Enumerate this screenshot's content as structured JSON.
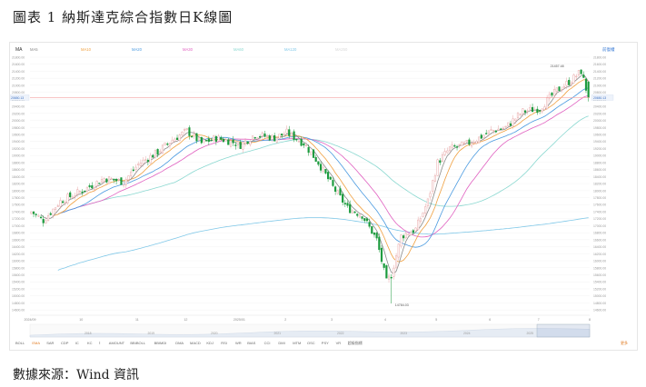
{
  "page": {
    "title": "圖表 1 納斯達克綜合指數日K線圖",
    "source": "數據來源：Wind 資訊"
  },
  "toolbar": {
    "ma_button": "MA",
    "ma_legend": [
      "MA5",
      "MA10",
      "MA20",
      "MA30",
      "MA60",
      "MA120",
      "MA250"
    ],
    "right_label": "前復權"
  },
  "colors": {
    "up": "#e8a8a8",
    "down": "#1a9a3c",
    "ma5": "#8a8a8a",
    "ma10": "#f0a040",
    "ma20": "#4a9ae0",
    "ma30": "#e060c0",
    "ma60": "#8ad8d0",
    "ma120": "#80c8e8",
    "ma250": "#d8d8d8",
    "highlight_line": "#f4a0a0"
  },
  "chart_data": {
    "type": "candlestick",
    "ylim": [
      14500,
      21800
    ],
    "y_ticks": [
      14600,
      14800,
      15000,
      15200,
      15400,
      15600,
      15800,
      16000,
      16200,
      16400,
      16600,
      16800,
      17000,
      17200,
      17400,
      17600,
      17800,
      18000,
      18200,
      18400,
      18600,
      18800,
      19000,
      19200,
      19400,
      19600,
      19800,
      20000,
      20200,
      20400,
      20600,
      20800,
      21000,
      21200,
      21400,
      21600,
      21800
    ],
    "x_labels": [
      "2024/09",
      "10",
      "11",
      "12",
      "2025/01",
      "2",
      "3",
      "4",
      "5",
      "6",
      "7",
      "8"
    ],
    "x_positions": [
      0,
      21,
      44,
      64,
      86,
      105,
      124,
      146,
      167,
      189,
      209,
      230
    ],
    "bars": 230,
    "current_price": 20650.13,
    "current_label": "20650.13",
    "high_annotation": {
      "label": "21457.48",
      "value": 21457.48,
      "index": 226
    },
    "low_annotation": {
      "label": "14784.03",
      "value": 14784.03,
      "index": 148
    },
    "close_anchors": [
      [
        0,
        17400
      ],
      [
        5,
        17150
      ],
      [
        12,
        17700
      ],
      [
        21,
        18000
      ],
      [
        30,
        18350
      ],
      [
        38,
        18250
      ],
      [
        44,
        18750
      ],
      [
        52,
        19100
      ],
      [
        58,
        19450
      ],
      [
        64,
        19700
      ],
      [
        70,
        19350
      ],
      [
        76,
        19500
      ],
      [
        82,
        19400
      ],
      [
        86,
        19300
      ],
      [
        92,
        19600
      ],
      [
        100,
        19500
      ],
      [
        105,
        19650
      ],
      [
        112,
        19350
      ],
      [
        118,
        18800
      ],
      [
        124,
        18100
      ],
      [
        130,
        17500
      ],
      [
        136,
        17300
      ],
      [
        142,
        16600
      ],
      [
        146,
        15400
      ],
      [
        148,
        15600
      ],
      [
        152,
        16700
      ],
      [
        158,
        16900
      ],
      [
        163,
        17700
      ],
      [
        167,
        18800
      ],
      [
        172,
        19200
      ],
      [
        178,
        19300
      ],
      [
        184,
        19500
      ],
      [
        189,
        19700
      ],
      [
        195,
        19800
      ],
      [
        202,
        20250
      ],
      [
        209,
        20350
      ],
      [
        216,
        20850
      ],
      [
        222,
        21150
      ],
      [
        226,
        21400
      ],
      [
        229,
        20650
      ]
    ],
    "timeline_years": [
      "2018",
      "2019",
      "2020",
      "2021",
      "2022",
      "2023",
      "2024",
      "2025"
    ],
    "indicator_tabs": [
      "BOLL",
      "EMA",
      "SAR",
      "CDP",
      "IC",
      "KC",
      "Ⅰ",
      "AMOUNT",
      "BBIBOLL",
      "BBIMDI",
      "DMA",
      "MACD",
      "KDJ",
      "RSI",
      "WR",
      "BIAS",
      "CCI",
      "DMI",
      "MTM",
      "OSC",
      "PSY",
      "VR",
      "超級指標"
    ],
    "active_indicator": "EMA",
    "bottom_right": "更多"
  }
}
